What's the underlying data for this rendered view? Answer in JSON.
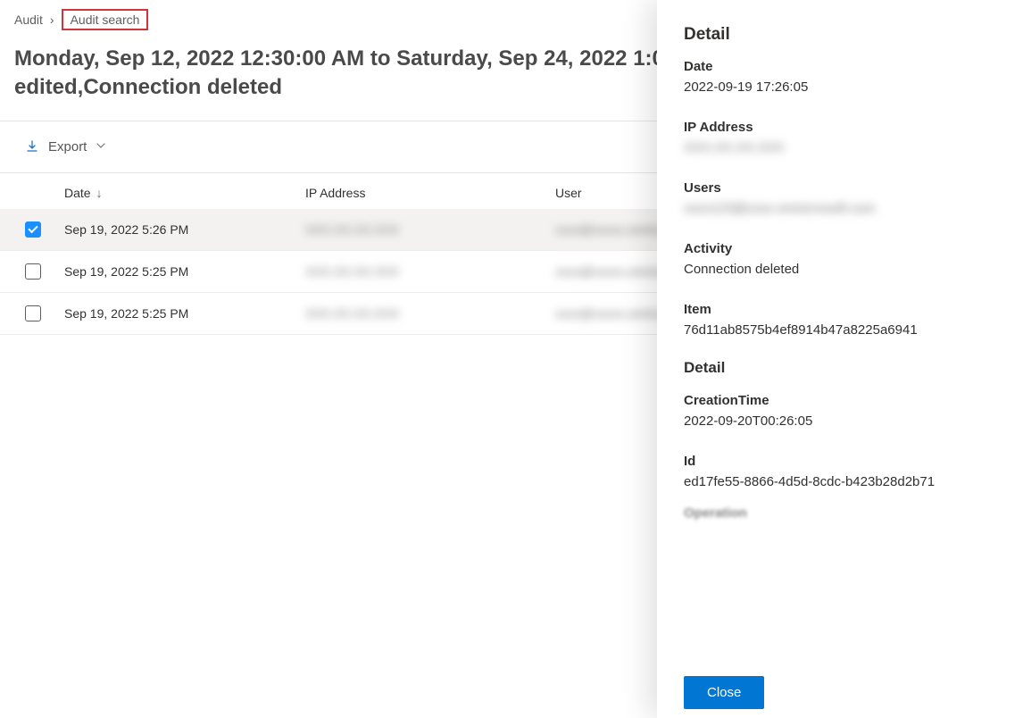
{
  "breadcrumb": {
    "parent": "Audit",
    "current": "Audit search"
  },
  "title": "Monday, Sep 12, 2022 12:30:00 AM to Saturday, Sep 24, 2022 1:0... created or edited,Connection edited,Connection deleted",
  "toolbar": {
    "export_label": "Export"
  },
  "table": {
    "headers": {
      "date": "Date",
      "ip": "IP Address",
      "user": "User"
    },
    "rows": [
      {
        "date": "Sep 19, 2022 5:26 PM",
        "ip": "XXX.XX.XX.XXX",
        "user": "xxxx@xxxxx.onmicrosoft.com",
        "selected": true
      },
      {
        "date": "Sep 19, 2022 5:25 PM",
        "ip": "XXX.XX.XX.XXX",
        "user": "xxxx@xxxxx.onmicrosoft.com",
        "selected": false
      },
      {
        "date": "Sep 19, 2022 5:25 PM",
        "ip": "XXX.XX.XX.XXX",
        "user": "xxxx@xxxxx.onmicrosoft.com",
        "selected": false
      }
    ]
  },
  "panel": {
    "title": "Detail",
    "date_label": "Date",
    "date_value": "2022-09-19 17:26:05",
    "ip_label": "IP Address",
    "ip_value": "XXX.XX.XX.XXX",
    "users_label": "Users",
    "users_value": "xxxx123@xxxx.onmicrosoft.com",
    "activity_label": "Activity",
    "activity_value": "Connection deleted",
    "item_label": "Item",
    "item_value": "76d11ab8575b4ef8914b47a8225a6941",
    "subtitle": "Detail",
    "creationtime_label": "CreationTime",
    "creationtime_value": "2022-09-20T00:26:05",
    "id_label": "Id",
    "id_value": "ed17fe55-8866-4d5d-8cdc-b423b28d2b71",
    "close_label": "Close"
  }
}
